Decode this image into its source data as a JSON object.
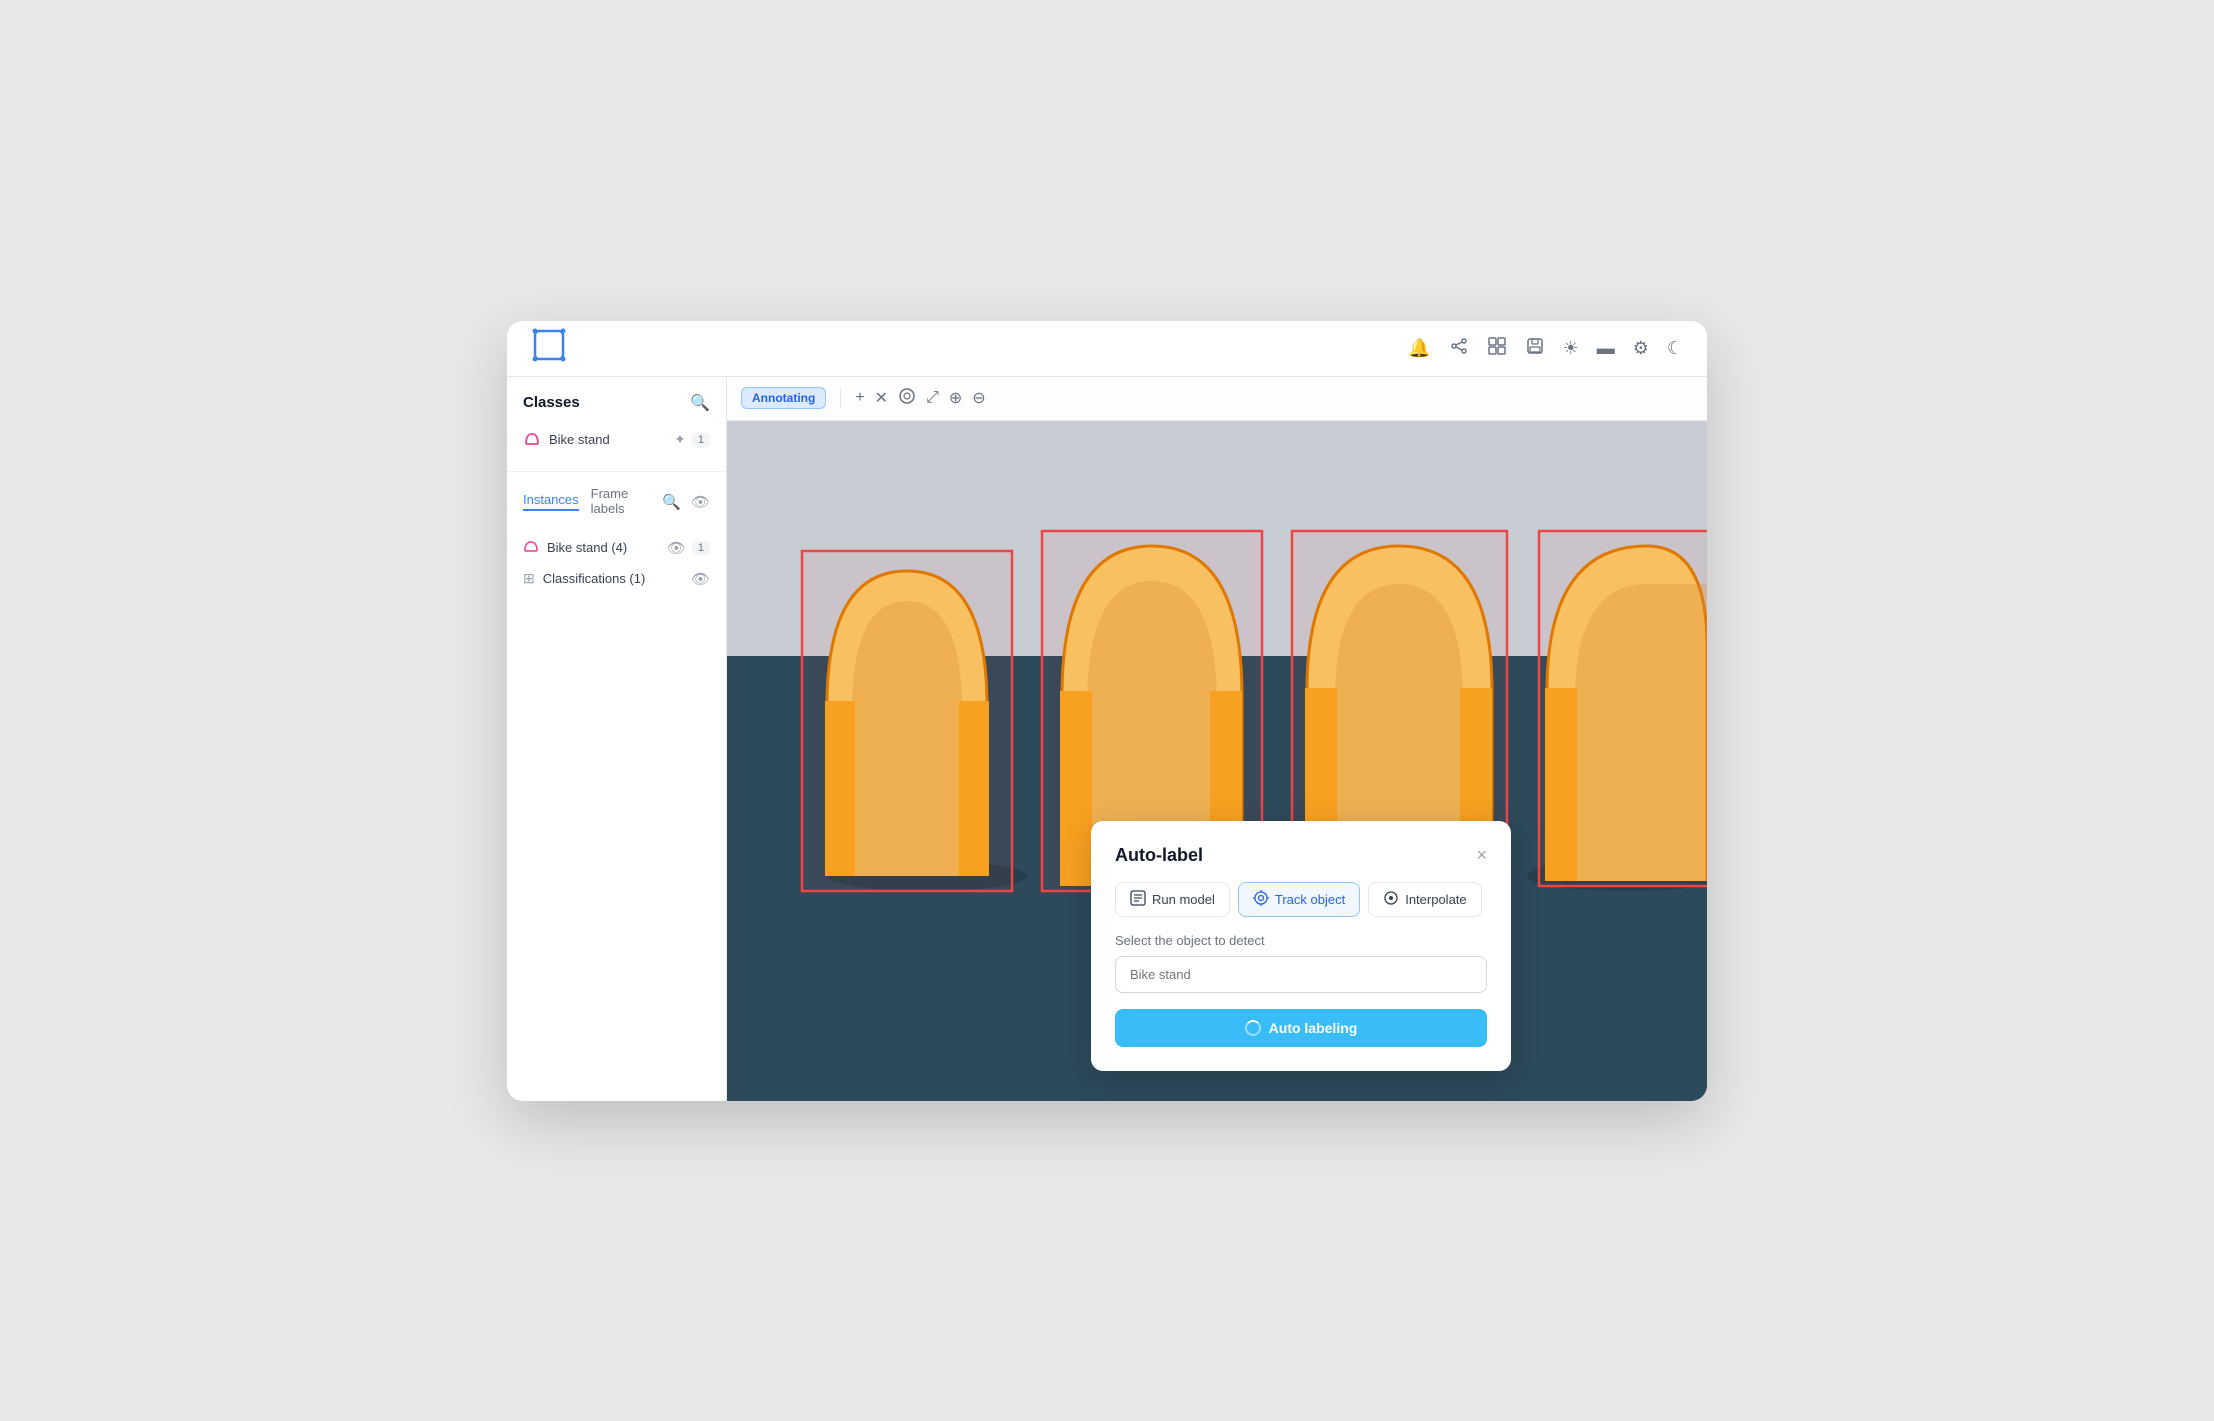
{
  "header": {
    "logo_symbol": "⬡",
    "icons": [
      "🔔",
      "⇈",
      "⊞",
      "⊟",
      "☀",
      "▬",
      "⚙",
      "☾"
    ]
  },
  "toolbar": {
    "annotating_label": "Annotating",
    "tools": [
      "+",
      "✕",
      "💬",
      "⤢",
      "⊕",
      "⊖"
    ]
  },
  "sidebar": {
    "classes_title": "Classes",
    "classes": [
      {
        "name": "Bike stand",
        "count": "1"
      }
    ],
    "instances_tab": "Instances",
    "frame_labels_tab": "Frame labels",
    "instances": [
      {
        "name": "Bike stand (4)",
        "count": "1"
      }
    ],
    "classifications": "Classifications (1)"
  },
  "modal": {
    "title": "Auto-label",
    "close": "×",
    "tabs": [
      {
        "icon": "▦",
        "label": "Run model",
        "active": false
      },
      {
        "icon": "◎",
        "label": "Track object",
        "active": true
      },
      {
        "icon": "◉",
        "label": "Interpolate",
        "active": false
      }
    ],
    "select_label": "Select the object to detect",
    "input_placeholder": "Bike stand",
    "button_label": "Auto labeling"
  }
}
